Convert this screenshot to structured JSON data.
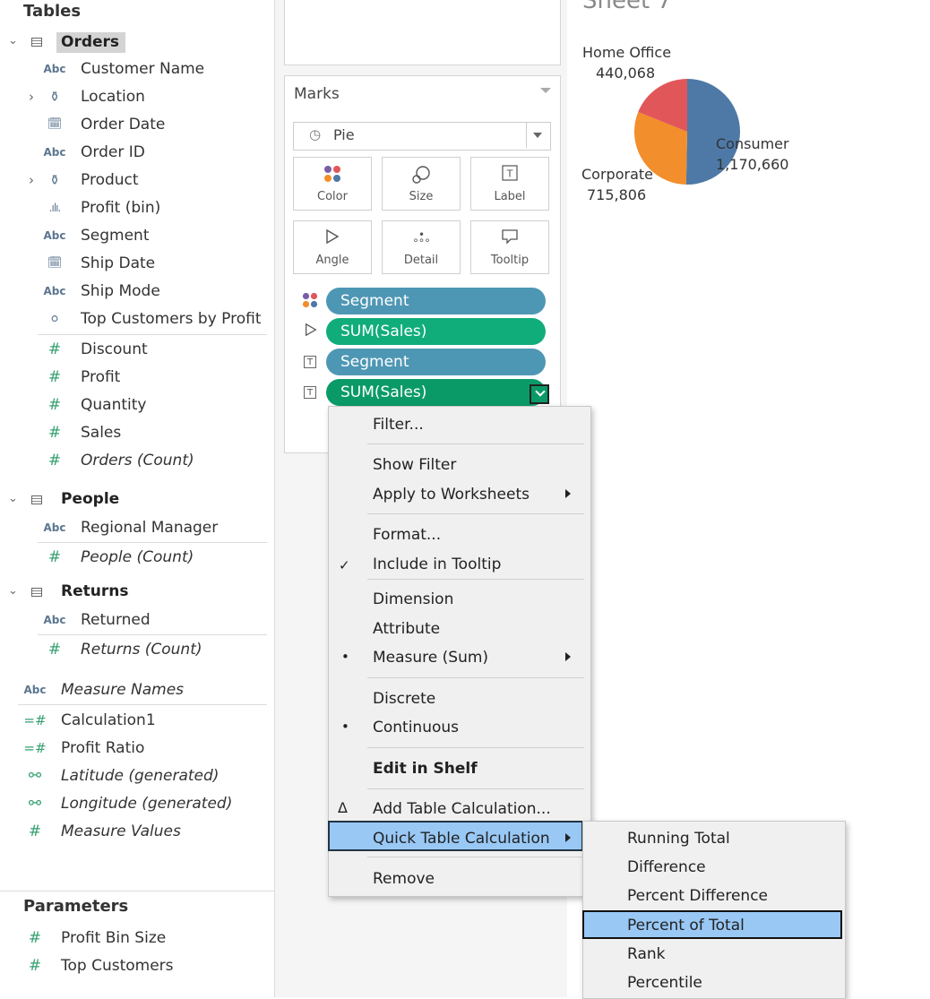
{
  "data_pane": {
    "tables_title": "Tables",
    "orders": {
      "name": "Orders",
      "fields": [
        {
          "label": "Customer Name",
          "type": "Abc"
        },
        {
          "label": "Location",
          "type": "hierarchy"
        },
        {
          "label": "Order Date",
          "type": "date"
        },
        {
          "label": "Order ID",
          "type": "Abc"
        },
        {
          "label": "Product",
          "type": "hierarchy"
        },
        {
          "label": "Profit (bin)",
          "type": "bin"
        },
        {
          "label": "Segment",
          "type": "Abc"
        },
        {
          "label": "Ship Date",
          "type": "date"
        },
        {
          "label": "Ship Mode",
          "type": "Abc"
        },
        {
          "label": "Top Customers by Profit",
          "type": "set"
        }
      ],
      "measures": [
        "Discount",
        "Profit",
        "Quantity",
        "Sales",
        "Orders (Count)"
      ]
    },
    "people": {
      "name": "People",
      "fields": [
        "Regional Manager"
      ],
      "measures": [
        "People (Count)"
      ]
    },
    "returns": {
      "name": "Returns",
      "fields": [
        "Returned"
      ],
      "measures": [
        "Returns (Count)"
      ]
    },
    "measure_names": "Measure Names",
    "extras": [
      "Calculation1",
      "Profit Ratio",
      "Latitude (generated)",
      "Longitude (generated)",
      "Measure Values"
    ],
    "parameters_title": "Parameters",
    "parameters": [
      "Profit Bin Size",
      "Top Customers"
    ],
    "type_abc": "Abc"
  },
  "marks": {
    "title": "Marks",
    "mark_type": "Pie",
    "buttons": [
      "Color",
      "Size",
      "Label",
      "Angle",
      "Detail",
      "Tooltip"
    ],
    "pills": [
      "Segment",
      "SUM(Sales)",
      "Segment",
      "SUM(Sales)"
    ]
  },
  "sheet": {
    "title": "Sheet 7",
    "labels": {
      "home_office": "Home Office",
      "home_office_value": "440,068",
      "consumer": "Consumer",
      "consumer_value": "1,170,660",
      "corporate": "Corporate",
      "corporate_value": "715,806"
    }
  },
  "chart_data": {
    "type": "pie",
    "categories": [
      "Consumer",
      "Corporate",
      "Home Office"
    ],
    "values": [
      1170660,
      715806,
      440068
    ],
    "colors": [
      "#4e79a7",
      "#f28e2b",
      "#e15759"
    ]
  },
  "context_menu": {
    "items": [
      "Filter...",
      "Show Filter",
      "Apply to Worksheets",
      "Format...",
      "Include in Tooltip",
      "Dimension",
      "Attribute",
      "Measure (Sum)",
      "Discrete",
      "Continuous",
      "Edit in Shelf",
      "Add Table Calculation...",
      "Quick Table Calculation",
      "Remove"
    ]
  },
  "submenu": {
    "items": [
      "Running Total",
      "Difference",
      "Percent Difference",
      "Percent of Total",
      "Rank",
      "Percentile"
    ]
  }
}
